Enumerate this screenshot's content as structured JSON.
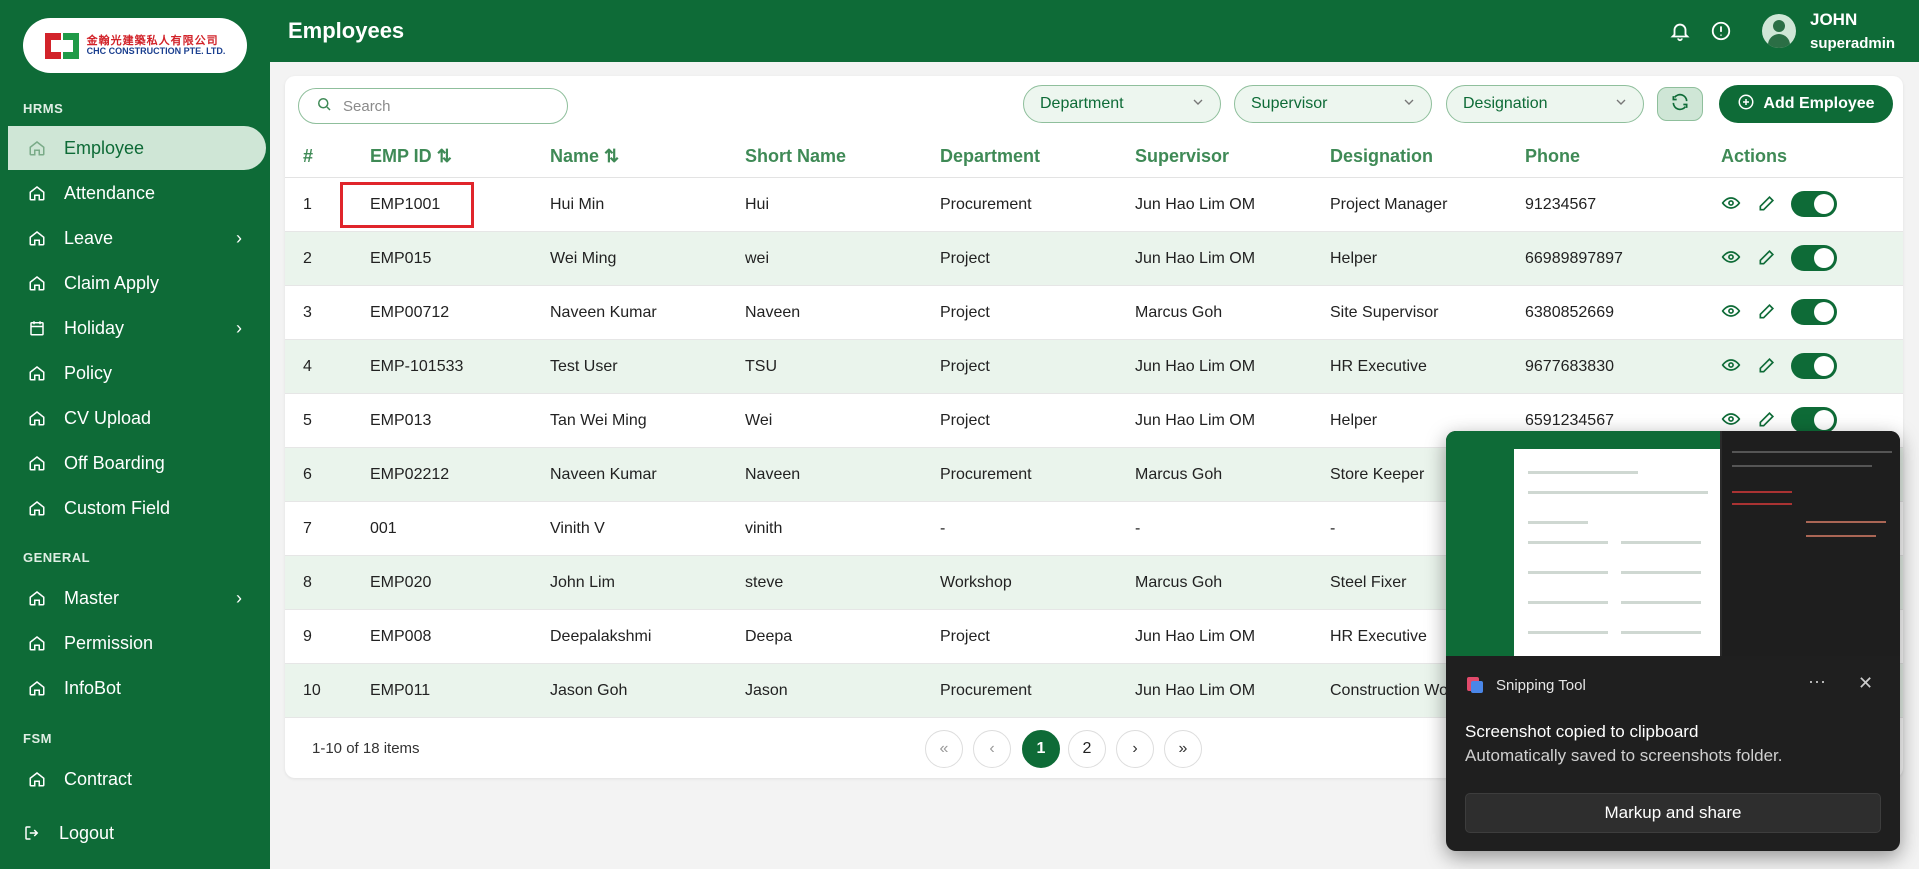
{
  "sidebar": {
    "logo": {
      "cn": "金翰光建築私人有限公司",
      "en": "CHC CONSTRUCTION PTE. LTD."
    },
    "sections": [
      {
        "label": "HRMS"
      },
      {
        "label": "GENERAL"
      },
      {
        "label": "FSM"
      }
    ],
    "items": [
      {
        "label": "Employee",
        "icon": "home-icon"
      },
      {
        "label": "Attendance",
        "icon": "home-icon"
      },
      {
        "label": "Leave",
        "icon": "home-icon"
      },
      {
        "label": "Claim Apply",
        "icon": "home-icon"
      },
      {
        "label": "Holiday",
        "icon": "calendar-icon"
      },
      {
        "label": "Policy",
        "icon": "home-icon"
      },
      {
        "label": "CV Upload",
        "icon": "home-icon"
      },
      {
        "label": "Off Boarding",
        "icon": "home-icon"
      },
      {
        "label": "Custom Field",
        "icon": "home-icon"
      },
      {
        "label": "Master",
        "icon": "home-icon"
      },
      {
        "label": "Permission",
        "icon": "home-icon"
      },
      {
        "label": "InfoBot",
        "icon": "home-icon"
      },
      {
        "label": "Contract",
        "icon": "home-icon"
      },
      {
        "label": "Logout",
        "icon": "logout-icon"
      }
    ]
  },
  "header": {
    "title": "Employees",
    "user_name": "JOHN",
    "user_role": "superadmin"
  },
  "toolbar": {
    "search_placeholder": "Search",
    "filters": [
      "Department",
      "Supervisor",
      "Designation"
    ],
    "add_label": "Add Employee"
  },
  "table": {
    "columns": [
      "#",
      "EMP ID",
      "Name",
      "Short Name",
      "Department",
      "Supervisor",
      "Designation",
      "Phone",
      "Actions"
    ],
    "rows": [
      {
        "n": "1",
        "id": "EMP1001",
        "name": "Hui Min",
        "short": "Hui",
        "dept": "Procurement",
        "sup": "Jun Hao Lim OM",
        "desig": "Project Manager",
        "phone": "91234567"
      },
      {
        "n": "2",
        "id": "EMP015",
        "name": "Wei Ming",
        "short": "wei",
        "dept": "Project",
        "sup": "Jun Hao Lim OM",
        "desig": "Helper",
        "phone": "66989897897"
      },
      {
        "n": "3",
        "id": "EMP00712",
        "name": "Naveen Kumar",
        "short": "Naveen",
        "dept": "Project",
        "sup": "Marcus Goh",
        "desig": "Site Supervisor",
        "phone": "6380852669"
      },
      {
        "n": "4",
        "id": "EMP-101533",
        "name": "Test User",
        "short": "TSU",
        "dept": "Project",
        "sup": "Jun Hao Lim OM",
        "desig": "HR Executive",
        "phone": "9677683830"
      },
      {
        "n": "5",
        "id": "EMP013",
        "name": "Tan Wei Ming",
        "short": "Wei",
        "dept": "Project",
        "sup": "Jun Hao Lim OM",
        "desig": "Helper",
        "phone": "6591234567"
      },
      {
        "n": "6",
        "id": "EMP02212",
        "name": "Naveen Kumar",
        "short": "Naveen",
        "dept": "Procurement",
        "sup": "Marcus Goh",
        "desig": "Store Keeper",
        "phone": ""
      },
      {
        "n": "7",
        "id": "001",
        "name": "Vinith V",
        "short": "vinith",
        "dept": "-",
        "sup": "-",
        "desig": "-",
        "phone": ""
      },
      {
        "n": "8",
        "id": "EMP020",
        "name": "John Lim",
        "short": "steve",
        "dept": "Workshop",
        "sup": "Marcus Goh",
        "desig": "Steel Fixer",
        "phone": ""
      },
      {
        "n": "9",
        "id": "EMP008",
        "name": "Deepalakshmi",
        "short": "Deepa",
        "dept": "Project",
        "sup": "Jun Hao Lim OM",
        "desig": "HR Executive",
        "phone": ""
      },
      {
        "n": "10",
        "id": "EMP011",
        "name": "Jason Goh",
        "short": "Jason",
        "dept": "Procurement",
        "sup": "Jun Hao Lim OM",
        "desig": "Construction Wo",
        "phone": ""
      }
    ]
  },
  "pagination": {
    "info": "1-10 of 18 items",
    "pages": [
      "1",
      "2"
    ],
    "current": "1"
  },
  "toast": {
    "app": "Snipping Tool",
    "more": "···",
    "close": "✕",
    "message": "Screenshot copied to clipboard",
    "sub": "Automatically saved to screenshots folder.",
    "button": "Markup and share"
  },
  "colors": {
    "brand": "#0e6b37",
    "highlight": "#e0252b"
  }
}
